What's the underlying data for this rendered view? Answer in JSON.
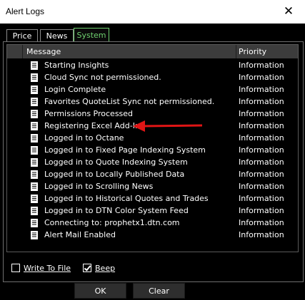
{
  "window": {
    "title": "Alert Logs",
    "close_glyph": "✕"
  },
  "tabs": [
    {
      "label": "Price",
      "active": false
    },
    {
      "label": "News",
      "active": false
    },
    {
      "label": "System",
      "active": true
    }
  ],
  "table": {
    "columns": {
      "message": "Message",
      "priority": "Priority"
    },
    "rows": [
      {
        "message": "Starting Insights",
        "priority": "Information"
      },
      {
        "message": "Cloud Sync not permissioned.",
        "priority": "Information"
      },
      {
        "message": "Login Complete",
        "priority": "Information"
      },
      {
        "message": "Favorites QuoteList Sync not permissioned.",
        "priority": "Information"
      },
      {
        "message": "Permissions Processed",
        "priority": "Information"
      },
      {
        "message": "Registering Excel Add-In",
        "priority": "Information"
      },
      {
        "message": "Logged in to Octane",
        "priority": "Information"
      },
      {
        "message": "Logged in to Fixed Page Indexing System",
        "priority": "Information"
      },
      {
        "message": "Logged in to Quote Indexing System",
        "priority": "Information"
      },
      {
        "message": "Logged in to Locally Published Data",
        "priority": "Information"
      },
      {
        "message": "Logged in to Scrolling News",
        "priority": "Information"
      },
      {
        "message": "Logged in to Historical Quotes and Trades",
        "priority": "Information"
      },
      {
        "message": "Logged in to DTN Color System Feed",
        "priority": "Information"
      },
      {
        "message": "Connecting to: prophetx1.dtn.com",
        "priority": "Information"
      },
      {
        "message": "Alert Mail Enabled",
        "priority": "Information"
      }
    ],
    "row_icon": "document-icon"
  },
  "annotation": {
    "icon": "red-arrow-icon",
    "color": "#e01515"
  },
  "options": {
    "write_to_file": {
      "label": "Write To File",
      "checked": false
    },
    "beep": {
      "label": "Beep",
      "checked": true
    }
  },
  "buttons": {
    "ok": "OK",
    "clear": "Clear"
  },
  "colors": {
    "active_tab": "#6fd06f",
    "background": "#000000",
    "header": "#3c3c3c"
  }
}
